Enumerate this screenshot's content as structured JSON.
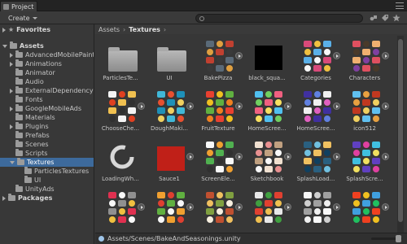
{
  "window": {
    "tab_title": "Project"
  },
  "toolbar": {
    "create_label": "Create",
    "search_value": "",
    "search_placeholder": ""
  },
  "tree": {
    "favorites": "Favorites",
    "assets": "Assets",
    "asset_folders": [
      "AdvancedMobilePaint",
      "Animations",
      "Animator",
      "Audio",
      "ExternalDependencyManager",
      "Fonts",
      "GoogleMobileAds",
      "Materials",
      "Plugins",
      "Prefabs",
      "Scenes",
      "Scripts"
    ],
    "selected": "Textures",
    "texture_children": [
      "ParticlesTextures",
      "UI"
    ],
    "after": [
      "UnityAds"
    ],
    "packages": "Packages"
  },
  "breadcrumb": {
    "root": "Assets",
    "current": "Textures"
  },
  "grid": [
    {
      "name": "ParticlesTe...",
      "kind": "folder",
      "colors": [
        "#b0b0b0"
      ]
    },
    {
      "name": "UI",
      "kind": "folder",
      "colors": [
        "#b0b0b0"
      ]
    },
    {
      "name": "BakePizza",
      "kind": "sheet",
      "colors": [
        "#5a6a78",
        "#e0a040",
        "#c04030",
        "#3a3a3a"
      ]
    },
    {
      "name": "black_squa...",
      "kind": "solid",
      "colors": [
        "#000000"
      ]
    },
    {
      "name": "Categories",
      "kind": "sheet",
      "colors": [
        "#d84a7a",
        "#f0c040",
        "#5ab0e8",
        "#f8f8f8"
      ]
    },
    {
      "name": "Characters",
      "kind": "sheet",
      "colors": [
        "#e05060",
        "#4a3a2a",
        "#f0b070",
        "#8040a0"
      ]
    },
    {
      "name": "ChooseChe...",
      "kind": "sheet",
      "colors": [
        "#f4f4f4",
        "#e04020",
        "#f0c050",
        "#303030"
      ]
    },
    {
      "name": "DoughMaki...",
      "kind": "sheet",
      "colors": [
        "#40b8d8",
        "#e85030",
        "#1e90b8",
        "#f0d060"
      ]
    },
    {
      "name": "FruitTexture",
      "kind": "sheet",
      "colors": [
        "#e84030",
        "#f0c020",
        "#60b040",
        "#f08020"
      ]
    },
    {
      "name": "HomeScree...",
      "kind": "sheet",
      "colors": [
        "#50c0f0",
        "#70d060",
        "#f06080",
        "#f8e060"
      ]
    },
    {
      "name": "HomeScree...",
      "kind": "sheet",
      "colors": [
        "#4030a0",
        "#6080e0",
        "#f0f0f0",
        "#e060c0"
      ]
    },
    {
      "name": "icon512",
      "kind": "sheet",
      "colors": [
        "#60c0f0",
        "#e8a040",
        "#c03820",
        "#f0d060"
      ]
    },
    {
      "name": "LoadingWh...",
      "kind": "ring",
      "colors": [
        "#d8d8d8"
      ]
    },
    {
      "name": "Sauce1",
      "kind": "solid",
      "colors": [
        "#c02018"
      ]
    },
    {
      "name": "ScreenEle...",
      "kind": "sheet",
      "colors": [
        "#f8f8f8",
        "#f0a030",
        "#50b050",
        "#303030"
      ]
    },
    {
      "name": "Sketchbook",
      "kind": "sheet",
      "colors": [
        "#f0e0d0",
        "#e89090",
        "#c0a080",
        "#f8f8f8"
      ]
    },
    {
      "name": "SplashLoad...",
      "kind": "sheet",
      "colors": [
        "#2a6080",
        "#70c0e0",
        "#f0c060",
        "#104060"
      ]
    },
    {
      "name": "SplashScre...",
      "kind": "sheet",
      "colors": [
        "#6040c0",
        "#e040a0",
        "#40c0e0",
        "#f0e060"
      ]
    },
    {
      "name": "",
      "kind": "sheet",
      "colors": [
        "#e03050",
        "#f8f8f8",
        "#909090",
        "#f0c040"
      ]
    },
    {
      "name": "",
      "kind": "sheet",
      "colors": [
        "#f0a030",
        "#e04030",
        "#60b040",
        "#f8f8f8"
      ]
    },
    {
      "name": "",
      "kind": "sheet",
      "colors": [
        "#c05030",
        "#f0c060",
        "#80a040",
        "#f8f0e0"
      ]
    },
    {
      "name": "",
      "kind": "sheet",
      "colors": [
        "#e8e8e8",
        "#40a040",
        "#e04030",
        "#f0c050"
      ]
    },
    {
      "name": "",
      "kind": "sheet",
      "colors": [
        "#f8f8f8",
        "#d0d0d0",
        "#a0a0a0",
        "#f0f0f0"
      ]
    },
    {
      "name": "",
      "kind": "sheet",
      "colors": [
        "#f04020",
        "#f0c020",
        "#40a0e0",
        "#20c060"
      ]
    }
  ],
  "status": {
    "path": "Assets/Scenes/BakeAndSeasonings.unity"
  }
}
